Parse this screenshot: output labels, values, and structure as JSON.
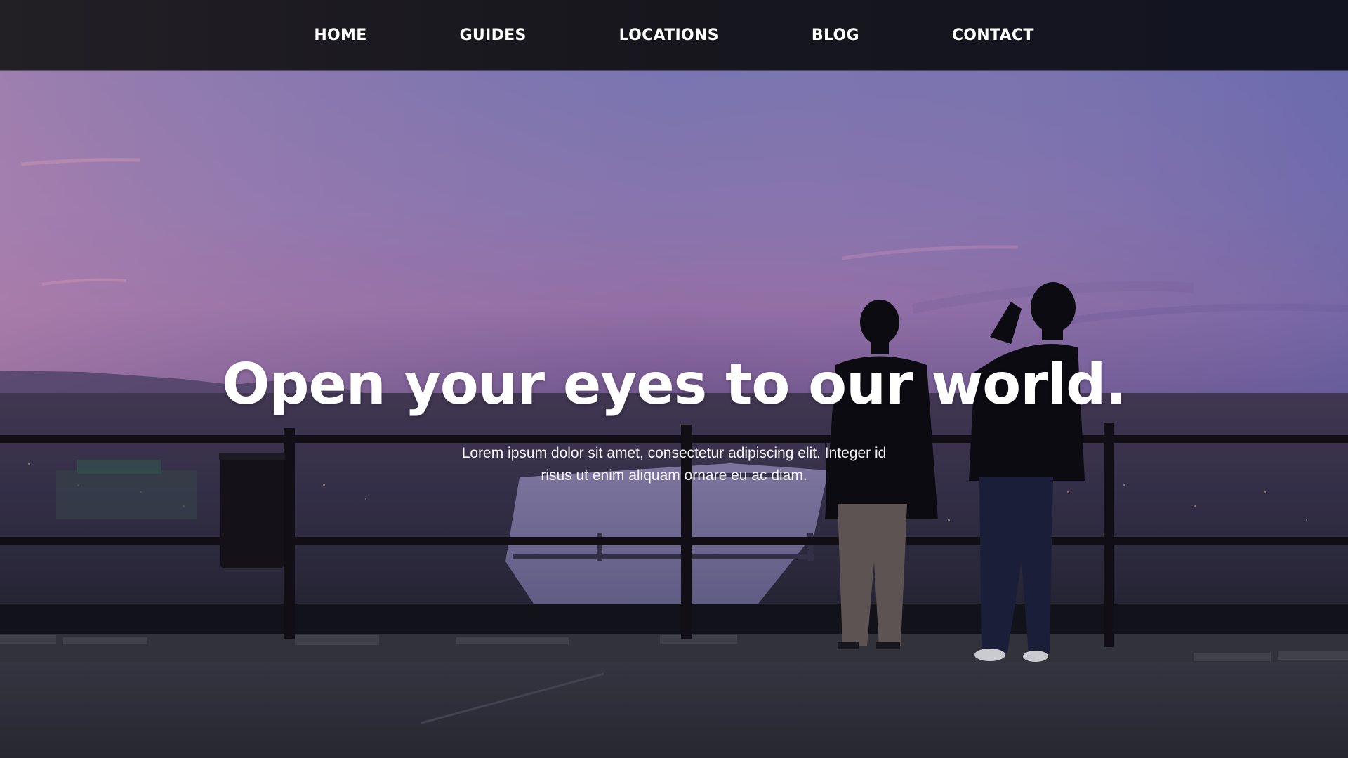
{
  "nav": {
    "items": [
      {
        "label": "HOME"
      },
      {
        "label": "GUIDES"
      },
      {
        "label": "LOCATIONS"
      },
      {
        "label": "BLOG"
      },
      {
        "label": "CONTACT"
      }
    ]
  },
  "hero": {
    "title": "Open your eyes to our world.",
    "subtitle": "Lorem ipsum dolor sit amet, consectetur adipiscing elit. Integer id risus ut enim aliquam ornare eu ac diam."
  },
  "colors": {
    "nav_bg": "#1a1820",
    "sky_top": "#7a7bc8",
    "sky_horizon": "#b98ac9",
    "text": "#ffffff"
  }
}
